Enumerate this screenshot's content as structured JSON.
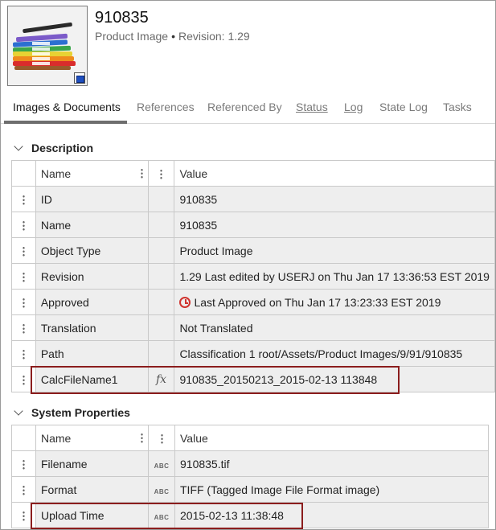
{
  "header": {
    "title": "910835",
    "object_type": "Product Image",
    "revision": "Revision: 1.29"
  },
  "tabs": [
    {
      "label": "Images & Documents",
      "active": true,
      "underline": false
    },
    {
      "label": "References",
      "active": false,
      "underline": false
    },
    {
      "label": "Referenced By",
      "active": false,
      "underline": false
    },
    {
      "label": "Status",
      "active": false,
      "underline": true
    },
    {
      "label": "Log",
      "active": false,
      "underline": true
    },
    {
      "label": "State Log",
      "active": false,
      "underline": false
    },
    {
      "label": "Tasks",
      "active": false,
      "underline": false
    }
  ],
  "description": {
    "title": "Description",
    "columns": {
      "name": "Name",
      "value": "Value"
    },
    "rows": [
      {
        "name": "ID",
        "value": "910835"
      },
      {
        "name": "Name",
        "value": "910835"
      },
      {
        "name": "Object Type",
        "value": "Product Image"
      },
      {
        "name": "Revision",
        "value": "1.29 Last edited by USERJ on Thu Jan 17 13:36:53 EST 2019"
      },
      {
        "name": "Approved",
        "value": "Last Approved on Thu Jan 17 13:23:33 EST 2019"
      },
      {
        "name": "Translation",
        "value": "Not Translated"
      },
      {
        "name": "Path",
        "value": "Classification 1 root/Assets/Product Images/9/91/910835"
      },
      {
        "name": "CalcFileName1",
        "value": "910835_20150213_2015-02-13 113848",
        "type_icon": "fx"
      }
    ]
  },
  "system_properties": {
    "title": "System Properties",
    "columns": {
      "name": "Name",
      "value": "Value"
    },
    "rows": [
      {
        "name": "Filename",
        "value": "910835.tif",
        "type_icon": "ABC"
      },
      {
        "name": "Format",
        "value": "TIFF (Tagged Image File Format image)",
        "type_icon": "ABC"
      },
      {
        "name": "Upload Time",
        "value": "2015-02-13 11:38:48",
        "type_icon": "ABC"
      }
    ]
  },
  "colors": {
    "highlight": "#8b1d1d",
    "approved_icon": "#d0332e",
    "row_bg": "#eeeeee"
  }
}
